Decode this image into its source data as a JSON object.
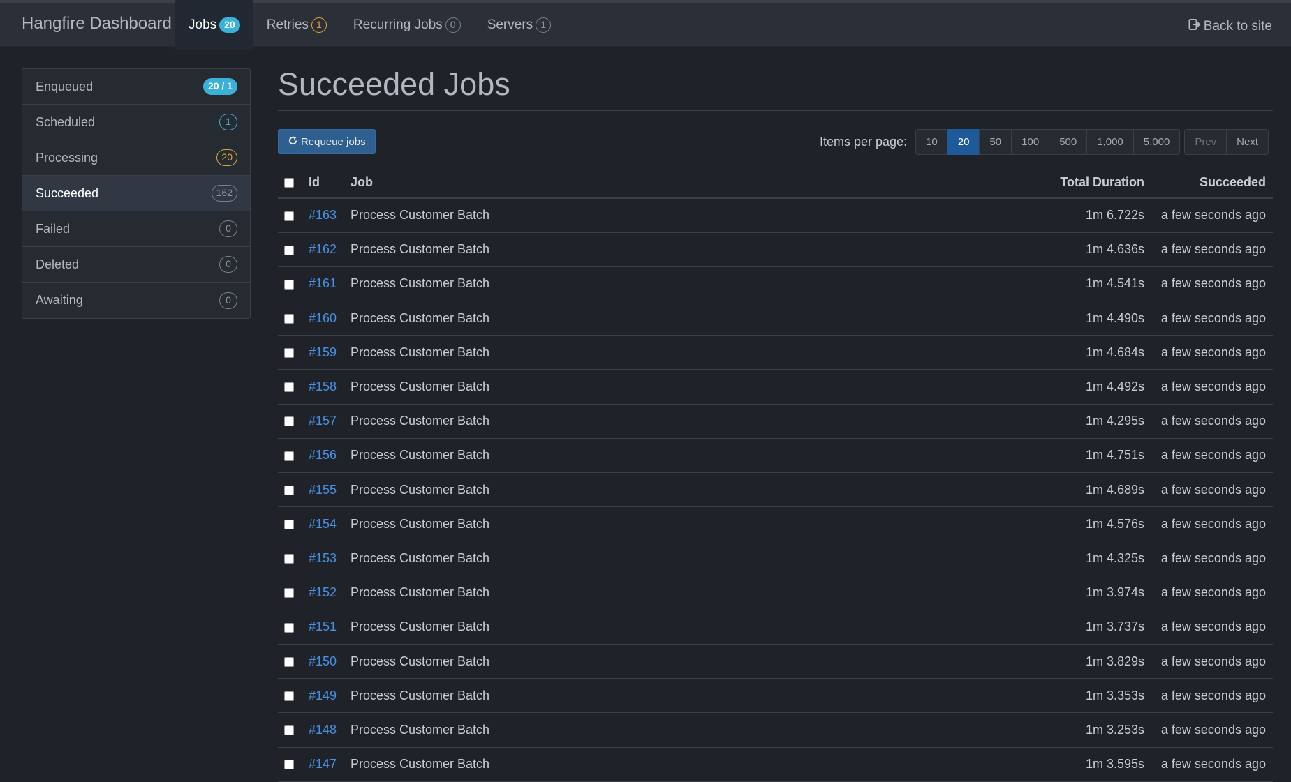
{
  "navbar": {
    "brand": "Hangfire Dashboard",
    "items": [
      {
        "label": "Jobs",
        "badge": "20",
        "active": true
      },
      {
        "label": "Retries",
        "badge": "1"
      },
      {
        "label": "Recurring Jobs",
        "badge": "0"
      },
      {
        "label": "Servers",
        "badge": "1"
      }
    ],
    "back_label": "Back to site"
  },
  "sidebar": {
    "items": [
      {
        "label": "Enqueued",
        "badge": "20 / 1"
      },
      {
        "label": "Scheduled",
        "badge": "1"
      },
      {
        "label": "Processing",
        "badge": "20"
      },
      {
        "label": "Succeeded",
        "badge": "162",
        "active": true
      },
      {
        "label": "Failed",
        "badge": "0"
      },
      {
        "label": "Deleted",
        "badge": "0"
      },
      {
        "label": "Awaiting",
        "badge": "0"
      }
    ]
  },
  "main": {
    "title": "Succeeded Jobs",
    "requeue_label": "Requeue jobs",
    "pager": {
      "label": "Items per page:",
      "sizes": [
        "10",
        "20",
        "50",
        "100",
        "500",
        "1,000",
        "5,000"
      ],
      "active_size": "20",
      "prev": "Prev",
      "next": "Next"
    },
    "table": {
      "headers": {
        "id": "Id",
        "job": "Job",
        "duration": "Total Duration",
        "succeeded": "Succeeded"
      },
      "rows": [
        {
          "id": "#163",
          "job": "Process Customer Batch",
          "duration": "1m 6.722s",
          "succeeded": "a few seconds ago"
        },
        {
          "id": "#162",
          "job": "Process Customer Batch",
          "duration": "1m 4.636s",
          "succeeded": "a few seconds ago"
        },
        {
          "id": "#161",
          "job": "Process Customer Batch",
          "duration": "1m 4.541s",
          "succeeded": "a few seconds ago"
        },
        {
          "id": "#160",
          "job": "Process Customer Batch",
          "duration": "1m 4.490s",
          "succeeded": "a few seconds ago"
        },
        {
          "id": "#159",
          "job": "Process Customer Batch",
          "duration": "1m 4.684s",
          "succeeded": "a few seconds ago"
        },
        {
          "id": "#158",
          "job": "Process Customer Batch",
          "duration": "1m 4.492s",
          "succeeded": "a few seconds ago"
        },
        {
          "id": "#157",
          "job": "Process Customer Batch",
          "duration": "1m 4.295s",
          "succeeded": "a few seconds ago"
        },
        {
          "id": "#156",
          "job": "Process Customer Batch",
          "duration": "1m 4.751s",
          "succeeded": "a few seconds ago"
        },
        {
          "id": "#155",
          "job": "Process Customer Batch",
          "duration": "1m 4.689s",
          "succeeded": "a few seconds ago"
        },
        {
          "id": "#154",
          "job": "Process Customer Batch",
          "duration": "1m 4.576s",
          "succeeded": "a few seconds ago"
        },
        {
          "id": "#153",
          "job": "Process Customer Batch",
          "duration": "1m 4.325s",
          "succeeded": "a few seconds ago"
        },
        {
          "id": "#152",
          "job": "Process Customer Batch",
          "duration": "1m 3.974s",
          "succeeded": "a few seconds ago"
        },
        {
          "id": "#151",
          "job": "Process Customer Batch",
          "duration": "1m 3.737s",
          "succeeded": "a few seconds ago"
        },
        {
          "id": "#150",
          "job": "Process Customer Batch",
          "duration": "1m 3.829s",
          "succeeded": "a few seconds ago"
        },
        {
          "id": "#149",
          "job": "Process Customer Batch",
          "duration": "1m 3.353s",
          "succeeded": "a few seconds ago"
        },
        {
          "id": "#148",
          "job": "Process Customer Batch",
          "duration": "1m 3.253s",
          "succeeded": "a few seconds ago"
        },
        {
          "id": "#147",
          "job": "Process Customer Batch",
          "duration": "1m 3.595s",
          "succeeded": "a few seconds ago"
        }
      ]
    }
  },
  "colors": {
    "background": "#1f2329",
    "navbar": "#2b3038",
    "link": "#4a90e2",
    "active_page": "#1e5a99",
    "badge_info": "#3cb1d8",
    "badge_warning": "#d9a441"
  },
  "icons": {
    "back": "sign-out-icon",
    "requeue": "refresh-icon"
  }
}
